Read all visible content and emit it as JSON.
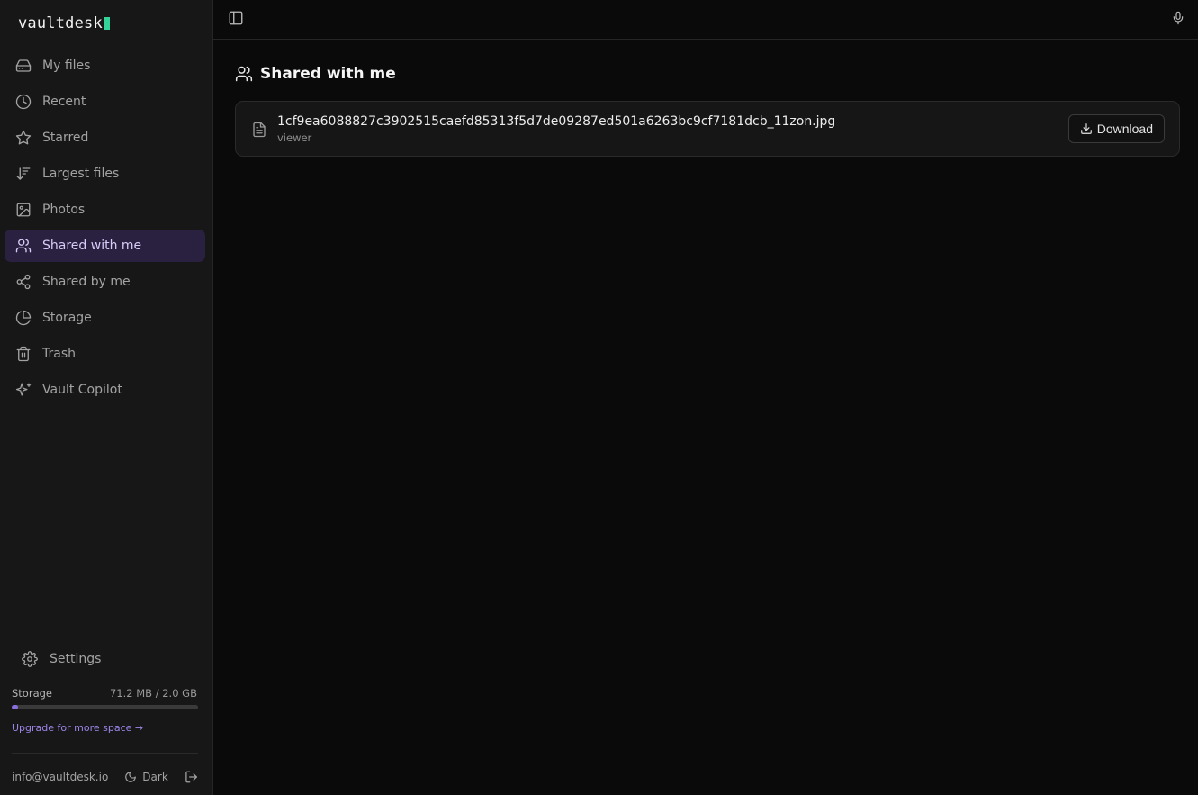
{
  "app": {
    "logo_text": "vaultdesk"
  },
  "sidebar": {
    "items": [
      {
        "label": "My files",
        "icon": "drive-icon",
        "active": false
      },
      {
        "label": "Recent",
        "icon": "clock-icon",
        "active": false
      },
      {
        "label": "Starred",
        "icon": "star-icon",
        "active": false
      },
      {
        "label": "Largest files",
        "icon": "sort-desc-icon",
        "active": false
      },
      {
        "label": "Photos",
        "icon": "image-icon",
        "active": false
      },
      {
        "label": "Shared with me",
        "icon": "users-icon",
        "active": true
      },
      {
        "label": "Shared by me",
        "icon": "share-icon",
        "active": false
      },
      {
        "label": "Storage",
        "icon": "pie-chart-icon",
        "active": false
      },
      {
        "label": "Trash",
        "icon": "trash-icon",
        "active": false
      },
      {
        "label": "Vault Copilot",
        "icon": "sparkles-icon",
        "active": false
      }
    ],
    "settings_label": "Settings",
    "storage": {
      "label": "Storage",
      "value": "71.2 MB / 2.0 GB",
      "used_fraction": 0.035
    },
    "upgrade_label": "Upgrade for more space →",
    "footer": {
      "email": "info@vaultdesk.io",
      "theme_label": "Dark"
    }
  },
  "main": {
    "title": "Shared with me",
    "files": [
      {
        "name": "1cf9ea6088827c3902515caefd85313f5d7de09287ed501a6263bc9cf7181dcb_11zon.jpg",
        "role": "viewer",
        "action_label": "Download"
      }
    ]
  },
  "colors": {
    "accent": "#8b6fe0",
    "active_bg": "#2a2140",
    "logo_cursor": "#34d399",
    "background": "#0a0a0a",
    "sidebar_bg": "#171717"
  }
}
